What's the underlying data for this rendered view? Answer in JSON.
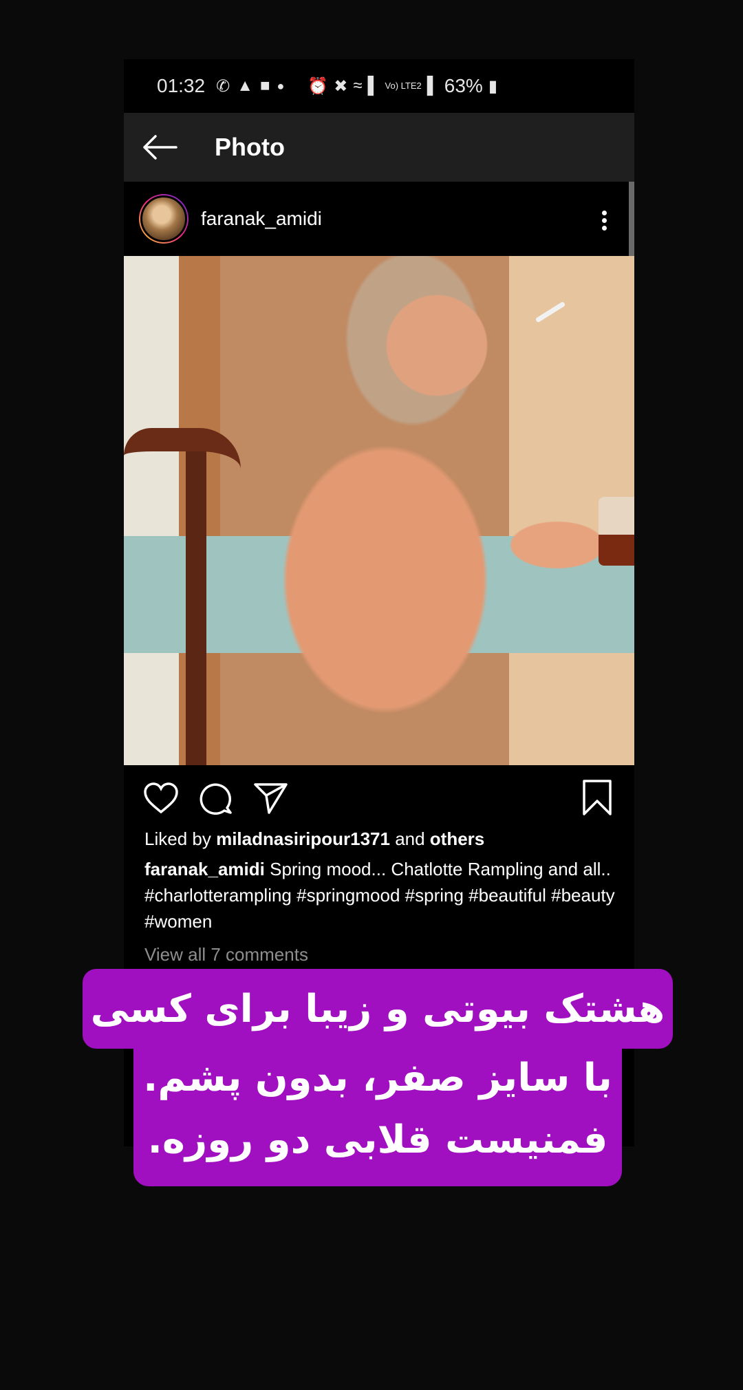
{
  "status_bar": {
    "time": "01:32",
    "battery": "63%",
    "network": "Vo) LTE2",
    "icons_left": [
      "whatsapp-icon",
      "notification-icon",
      "message-icon",
      "dot-icon"
    ],
    "icons_right": [
      "alarm-icon",
      "mute-icon",
      "wifi-icon",
      "signal-icon",
      "signal-icon",
      "battery-icon"
    ]
  },
  "app_bar": {
    "title": "Photo"
  },
  "post": {
    "username": "faranak_amidi",
    "liked_by_prefix": "Liked by ",
    "liked_by_user": "miladnasiripour1371",
    "liked_by_and": " and ",
    "liked_by_others": "others",
    "caption_user": "faranak_amidi",
    "caption_text": " Spring mood... Chatlotte Rampling and all.. #charlotterampling #springmood #spring #beautiful #beauty #women",
    "view_comments": "View all 7 comments"
  },
  "overlay": {
    "line1": "هشتک بیوتی و زیبا برای کسی",
    "line2": "با سایز صفر، بدون پشم.",
    "line3": "فمنیست قلابی دو روزه.",
    "background": "#a00fc0"
  },
  "colors": {
    "appbar_bg": "#1f1f1f",
    "page_bg": "#0a0a0a",
    "muted_text": "#8e8e8e"
  }
}
